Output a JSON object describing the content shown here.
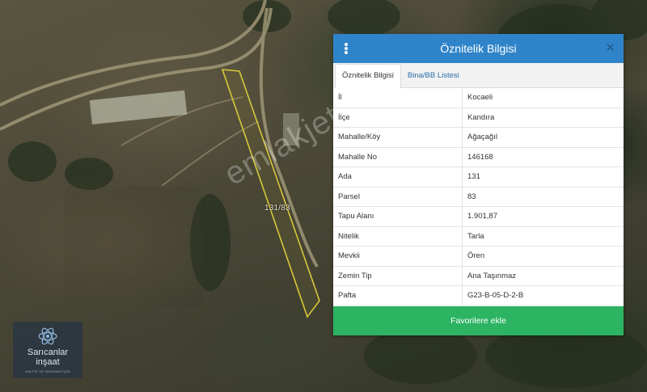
{
  "map": {
    "parcel_label": "131/83",
    "watermark": "emlakjet.com"
  },
  "logo": {
    "name_line1": "Sarıcanlar",
    "name_line2": "inşaat",
    "tagline": "KALİTE VE GÜVENİN İÇİN"
  },
  "panel": {
    "title": "Öznitelik Bilgisi",
    "close_symbol": "✕",
    "tabs": [
      {
        "label": "Öznitelik Bilgisi",
        "active": true
      },
      {
        "label": "Bina/BB Listesi",
        "active": false
      }
    ],
    "rows": [
      {
        "key": "İl",
        "value": "Kocaeli"
      },
      {
        "key": "İlçe",
        "value": "Kandıra"
      },
      {
        "key": "Mahalle/Köy",
        "value": "Ağaçağıl"
      },
      {
        "key": "Mahalle No",
        "value": "146168"
      },
      {
        "key": "Ada",
        "value": "131"
      },
      {
        "key": "Parsel",
        "value": "83"
      },
      {
        "key": "Tapu Alanı",
        "value": "1.901,87"
      },
      {
        "key": "Nitelik",
        "value": "Tarla"
      },
      {
        "key": "Mevkii",
        "value": "Ören"
      },
      {
        "key": "Zemin Tip",
        "value": "Ana Taşınmaz"
      },
      {
        "key": "Pafta",
        "value": "G23-B-05-D-2-B"
      }
    ],
    "favorite_button": "Favorilere ekle"
  },
  "colors": {
    "header_blue": "#2f84c9",
    "button_green": "#2cb463",
    "parcel_outline": "#d8c83a",
    "tab_link": "#2a6ea8"
  },
  "icons": {
    "menu": "vertical-dots-icon",
    "close": "close-icon",
    "logo": "atom-icon"
  }
}
